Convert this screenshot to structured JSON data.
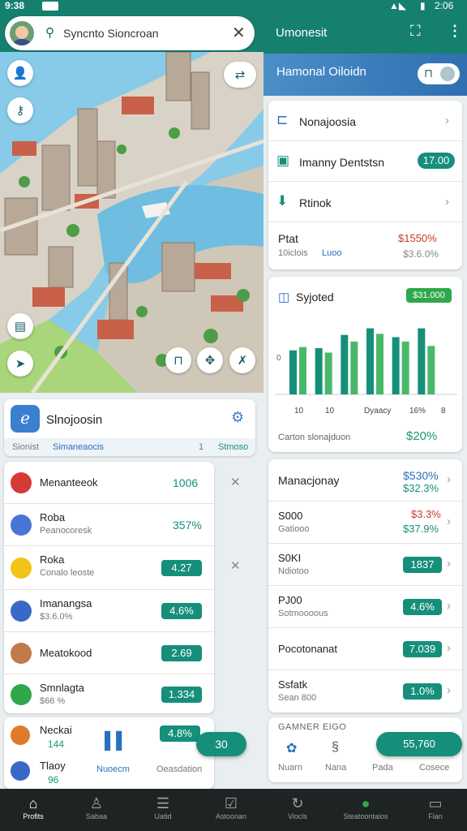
{
  "status": {
    "time_left": "9:38",
    "time_right": "2:06"
  },
  "search": {
    "query": "Syncnto Sioncroan"
  },
  "appbar": {
    "title": "Umonesit"
  },
  "header_card": {
    "title": "Hamonal Oiloidn"
  },
  "menu": [
    {
      "label": "Nonajoosia"
    },
    {
      "label": "Imanny Dentstsn",
      "badge": "17.00"
    },
    {
      "label": "Rtinok"
    }
  ],
  "stat": {
    "label": "Ptat",
    "sub1": "10iclois",
    "sub2": "Luoo",
    "val1": "$1550%",
    "val2": "$3.6.0%"
  },
  "chart_card": {
    "title": "Syjoted",
    "badge": "$31.000",
    "ticks": [
      "10",
      "10",
      "Dyaacy",
      "16%",
      "8"
    ],
    "y_tick": "0",
    "footer_label": "Carton slonajduon",
    "footer_value": "$20%"
  },
  "chart_data": {
    "type": "bar",
    "categories": [
      "10",
      "10",
      "Dyaacy",
      "16%",
      "8"
    ],
    "series": [
      {
        "values": [
          40,
          42,
          54,
          60,
          52,
          60
        ]
      },
      {
        "values": [
          43,
          38,
          48,
          55,
          48,
          44
        ]
      }
    ],
    "ylim": [
      0,
      70
    ]
  },
  "map_controls": [
    "user-icon",
    "bag-icon",
    "doc-icon",
    "cursor-icon"
  ],
  "info_card": {
    "title": "Slnojoosin",
    "sub_left": "Sionist",
    "sub_mid": "Simaneaocis",
    "sub_num": "1",
    "sub_right": "Stmoso"
  },
  "left_list": [
    {
      "title": "Menanteeok",
      "sub": "",
      "value": "1006",
      "style": "text",
      "icon_color": "#d53a36"
    },
    {
      "title": "Roba",
      "sub": "Peanocoresk",
      "value": "357%",
      "style": "text",
      "icon_color": "#4a74d6"
    },
    {
      "title": "Roka",
      "sub": "Conalo leoste",
      "value": "4.27",
      "style": "pill",
      "icon_color": "#f3c316"
    },
    {
      "title": "Imanangsa",
      "sub": "$3.6.0%",
      "value": "4.6%",
      "style": "pill",
      "icon_color": "#3a68c8"
    },
    {
      "title": "Meatokood",
      "sub": "",
      "value": "2.69",
      "style": "pill",
      "icon_color": "#c27a4a"
    },
    {
      "title": "Smnlagta",
      "sub": "$66 %",
      "value": "1.334",
      "style": "pill",
      "icon_color": "#2ea84a"
    },
    {
      "title": "Neckai",
      "sub": "144",
      "value": "4.8%",
      "style": "pill",
      "icon_color": "#e07a2a"
    },
    {
      "title": "Tlaoy",
      "sub": "96",
      "value": "",
      "style": "none",
      "icon_color": "#3a68c8"
    }
  ],
  "left_bottom": {
    "mid_label": "Nuoecm",
    "right_label": "Oeasdation",
    "float_pill": "30"
  },
  "right_card": {
    "title": "Manacjonay",
    "title_val1": "$530%",
    "title_val2": "$32.3%",
    "rows": [
      {
        "title": "S000",
        "sub": "Gatiooo",
        "v1": "$3.3%",
        "v2": "$37.9%",
        "style": "text"
      },
      {
        "title": "S0KI",
        "sub": "Ndiotoo",
        "v1": "1837",
        "style": "pill"
      },
      {
        "title": "PJ00",
        "sub": "Sotmoooous",
        "v1": "4.6%",
        "style": "pill"
      },
      {
        "title": "Pocotonanat",
        "sub": "",
        "v1": "7.039",
        "style": "pill"
      },
      {
        "title": "Ssfatk",
        "sub": "Sean 800",
        "v1": "1.0%",
        "style": "pill"
      }
    ]
  },
  "right_bottom": {
    "header": "GAMNER EIGO",
    "items": [
      "Nuarn",
      "Nana",
      "Pada",
      "Cosece"
    ],
    "pill": "55,760"
  },
  "nav": [
    "Profits",
    "Sabaa",
    "Uatid",
    "Astoonan",
    "Viocls",
    "Steatoontaios",
    "Fian"
  ]
}
